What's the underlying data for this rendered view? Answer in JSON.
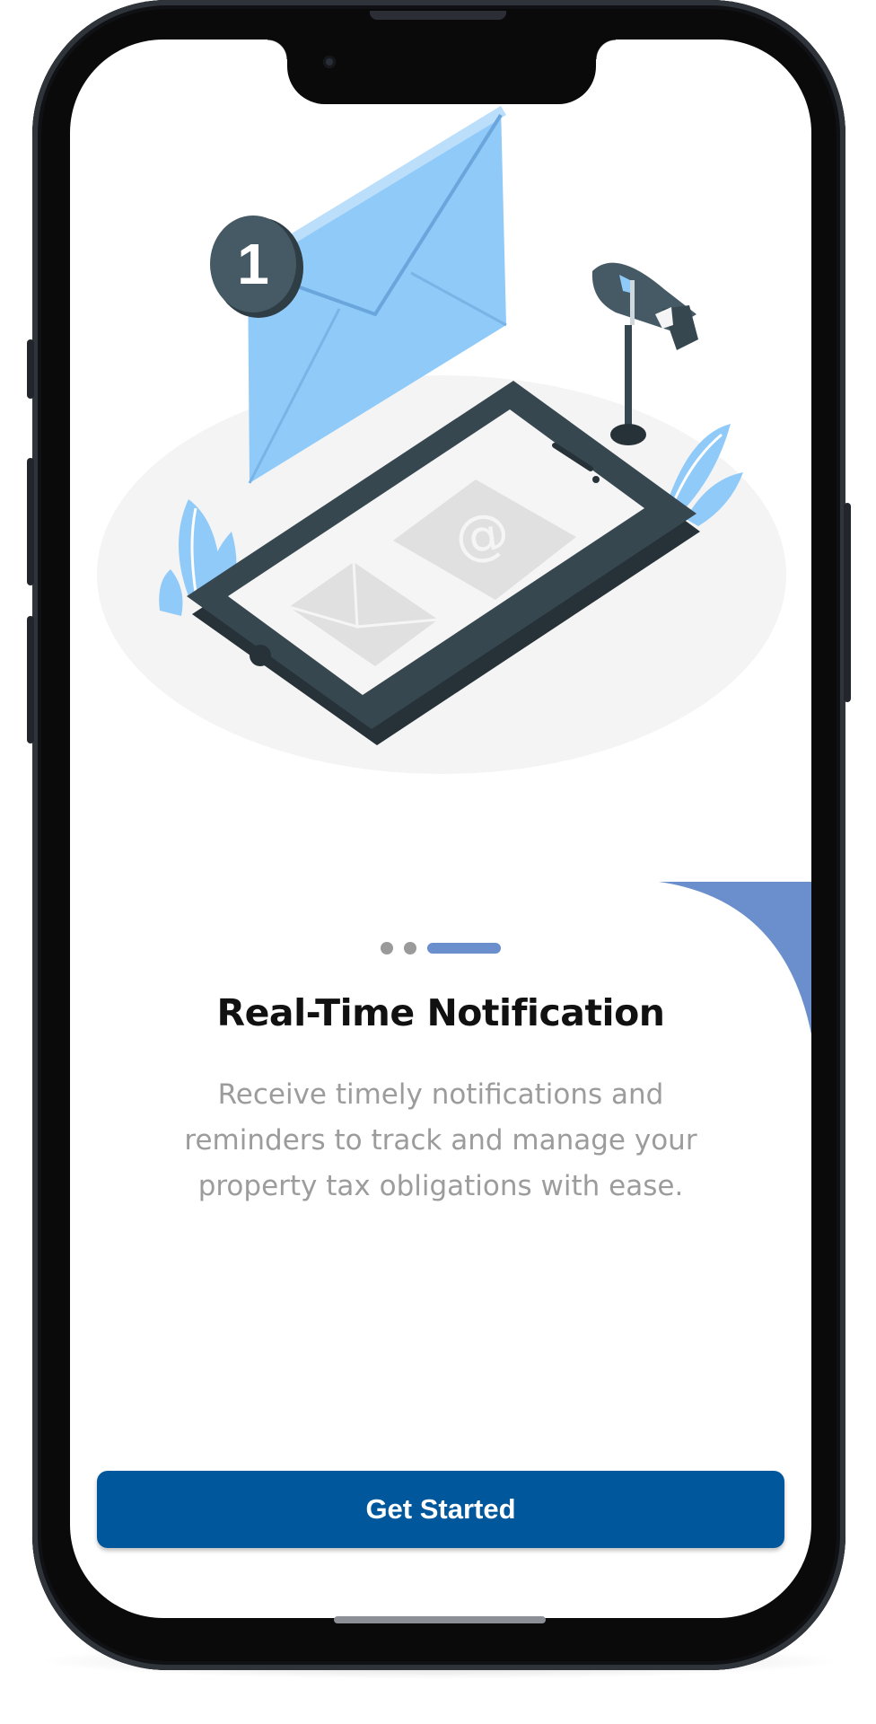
{
  "onboarding": {
    "title": "Real-Time Notification",
    "description": "Receive timely notifications and reminders to track and manage your property tax obligations with ease.",
    "page_indicator": {
      "total": 3,
      "active_index": 2
    },
    "cta_label": "Get Started"
  },
  "illustration": {
    "badge_count": "1",
    "icons": [
      "envelope-icon",
      "mailbox-icon",
      "phone-icon",
      "at-sign-icon",
      "mail-icon",
      "leaf-icon"
    ]
  },
  "colors": {
    "accent": "#6a8fcc",
    "button": "#01579b",
    "title": "#111111",
    "description": "#9c9c9c",
    "envelope": "#90caf9"
  }
}
